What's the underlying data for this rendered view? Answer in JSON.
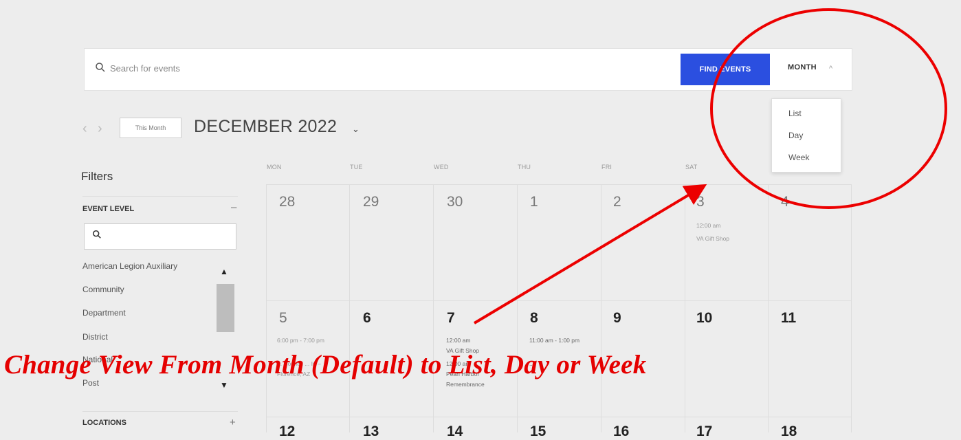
{
  "search": {
    "placeholder": "Search for events",
    "find_button": "FIND EVENTS",
    "view_toggle": "MONTH"
  },
  "view_menu": {
    "items": [
      "List",
      "Day",
      "Week"
    ]
  },
  "nav": {
    "this_month": "This Month",
    "title": "DECEMBER 2022"
  },
  "filters": {
    "heading": "Filters",
    "event_level_label": "EVENT LEVEL",
    "event_level_items": [
      "American Legion Auxiliary",
      "Community",
      "Department",
      "District",
      "National",
      "Post"
    ],
    "locations_label": "LOCATIONS"
  },
  "calendar": {
    "weekdays": [
      "MON",
      "TUE",
      "WED",
      "THU",
      "FRI",
      "SAT",
      "SUN"
    ],
    "week1": [
      "28",
      "29",
      "30",
      "1",
      "2",
      "3",
      "4"
    ],
    "week2": [
      "5",
      "6",
      "7",
      "8",
      "9",
      "10",
      "11"
    ],
    "week3": [
      "12",
      "13",
      "14",
      "15",
      "16",
      "17",
      "18"
    ],
    "events": {
      "sat3": {
        "time": "12:00 am",
        "title": "VA Gift Shop"
      },
      "mon5": {
        "time": "6:00 pm - 7:00 pm",
        "title": "... Council ... In – Florence, AZ"
      },
      "wed7": {
        "time1": "12:00 am",
        "title1": "VA Gift Shop",
        "time2": "12:00 am",
        "title2": "Pearl Harbor Remembrance"
      },
      "thu8": {
        "time": "11:00 am - 1:00 pm",
        "title": "..."
      }
    }
  },
  "annotation": {
    "caption": "Change View From Month (Default) to List, Day or Week"
  },
  "colors": {
    "accent": "#2b4fe0",
    "annotation": "#e50000"
  }
}
